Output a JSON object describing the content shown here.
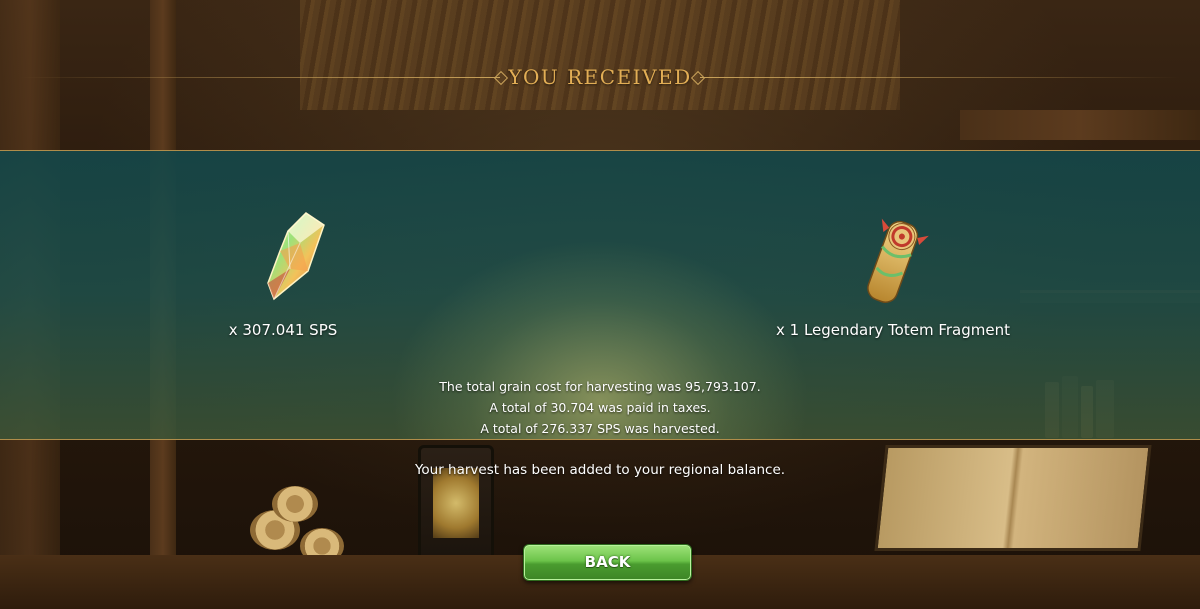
{
  "header": {
    "title": "YOU RECEIVED"
  },
  "rewards": [
    {
      "icon": "sps-crystal-icon",
      "label": "x 307.041 SPS"
    },
    {
      "icon": "legendary-totem-fragment-icon",
      "label": "x 1 Legendary Totem Fragment"
    }
  ],
  "summary": {
    "line1": "The total grain cost for harvesting was 95,793.107.",
    "line2": "A total of 30.704 was paid in taxes.",
    "line3": "A total of 276.337 SPS was harvested."
  },
  "notice": "Your harvest has been added to your regional balance.",
  "buttons": {
    "back_label": "BACK"
  },
  "colors": {
    "title_gold": "#e2ae55",
    "panel_teal": "#1e5a5a",
    "button_green": "#6cc44a"
  }
}
